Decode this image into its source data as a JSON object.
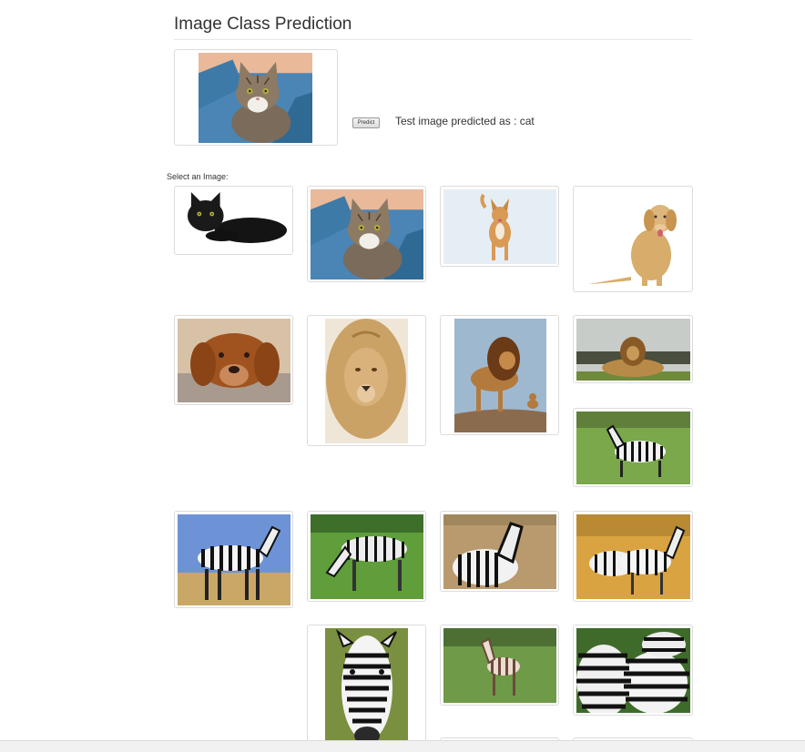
{
  "page": {
    "title": "Image Class Prediction"
  },
  "prediction": {
    "button_label": "Predict",
    "result_text": "Test image predicted as : cat"
  },
  "gallery": {
    "label": "Select an Image:",
    "images": [
      {
        "subject": "black cat lying"
      },
      {
        "subject": "tabby cat held by person"
      },
      {
        "subject": "dog in snow"
      },
      {
        "subject": "golden retriever sitting"
      },
      {
        "subject": "brown dog resting head"
      },
      {
        "subject": "lion face portrait"
      },
      {
        "subject": "lion standing on rock"
      },
      {
        "subject": "lion lying in grass"
      },
      {
        "subject": "zebra on green grass"
      },
      {
        "subject": "zebra under blue sky"
      },
      {
        "subject": "zebra grazing on grass"
      },
      {
        "subject": "zebra on dry plain"
      },
      {
        "subject": "two zebras in savanna"
      },
      {
        "subject": "zebra head close-up"
      },
      {
        "subject": "zebra foal"
      },
      {
        "subject": "group of zebras"
      }
    ]
  }
}
